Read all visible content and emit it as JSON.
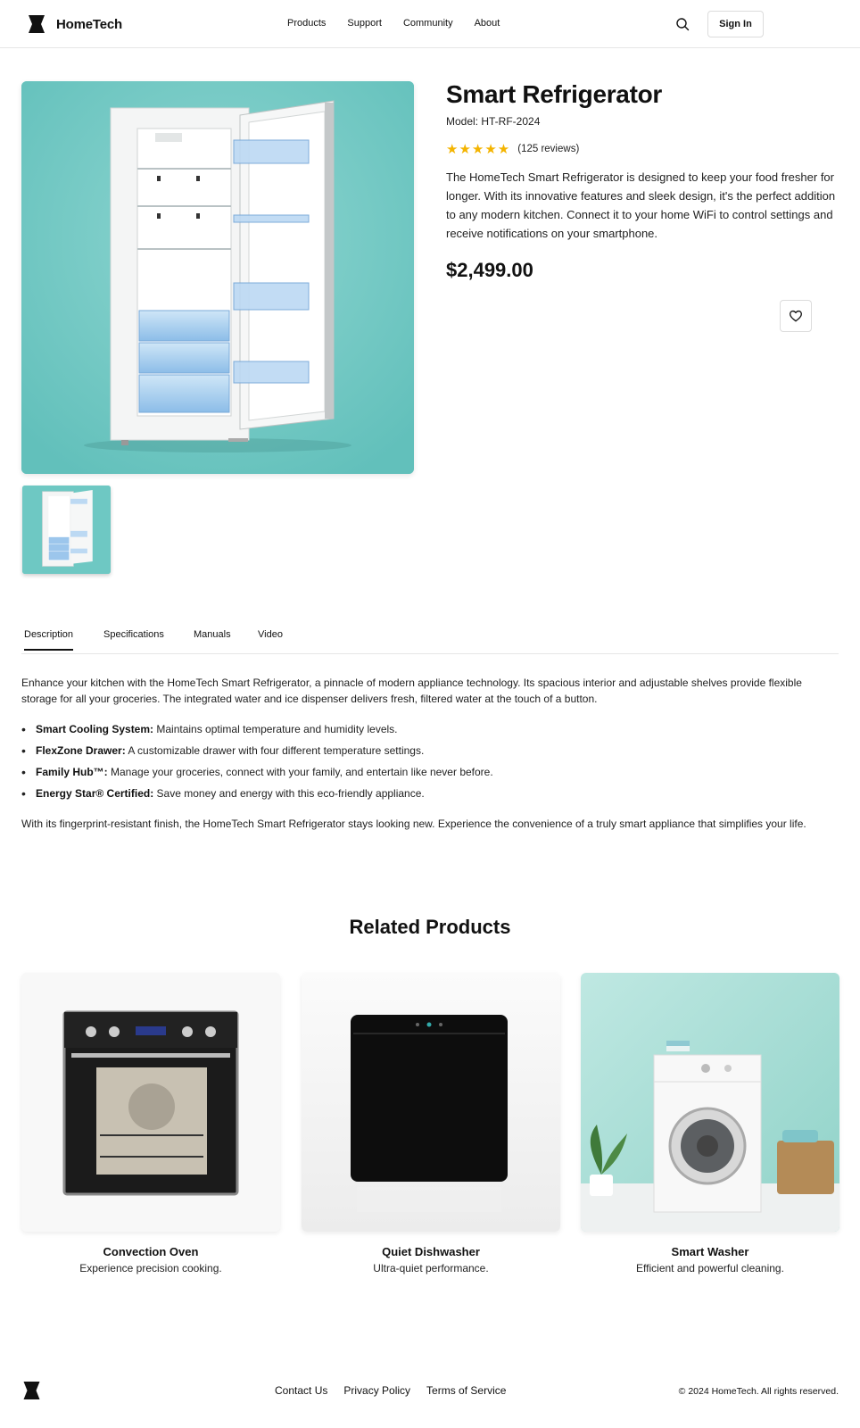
{
  "header": {
    "brand": "HomeTech",
    "nav": [
      "Products",
      "Support",
      "Community",
      "About"
    ],
    "signin": "Sign In"
  },
  "product": {
    "title": "Smart Refrigerator",
    "model": "Model: HT-RF-2024",
    "stars": "★★★★★",
    "rating_value": 5,
    "reviews": "(125 reviews)",
    "description": "The HomeTech Smart Refrigerator is designed to keep your food fresher for longer. With its innovative features and sleek design, it's the perfect addition to any modern kitchen. Connect it to your home WiFi to control settings and receive notifications on your smartphone.",
    "price": "$2,499.00"
  },
  "tabs": [
    "Description",
    "Specifications",
    "Manuals",
    "Video"
  ],
  "description": {
    "intro": "Enhance your kitchen with the HomeTech Smart Refrigerator, a pinnacle of modern appliance technology. Its spacious interior and adjustable shelves provide flexible storage for all your groceries. The integrated water and ice dispenser delivers fresh, filtered water at the touch of a button.",
    "features": [
      {
        "name": "Smart Cooling System:",
        "text": " Maintains optimal temperature and humidity levels."
      },
      {
        "name": "FlexZone Drawer:",
        "text": " A customizable drawer with four different temperature settings."
      },
      {
        "name": "Family Hub™:",
        "text": " Manage your groceries, connect with your family, and entertain like never before."
      },
      {
        "name": "Energy Star® Certified:",
        "text": " Save money and energy with this eco-friendly appliance."
      }
    ],
    "outro": "With its fingerprint-resistant finish, the HomeTech Smart Refrigerator stays looking new. Experience the convenience of a truly smart appliance that simplifies your life."
  },
  "related": {
    "title": "Related Products",
    "items": [
      {
        "name": "Convection Oven",
        "tagline": "Experience precision cooking."
      },
      {
        "name": "Quiet Dishwasher",
        "tagline": "Ultra-quiet performance."
      },
      {
        "name": "Smart Washer",
        "tagline": "Efficient and powerful cleaning."
      }
    ]
  },
  "footer": {
    "links": [
      "Contact Us",
      "Privacy Policy",
      "Terms of Service"
    ],
    "copyright": "© 2024 HomeTech. All rights reserved."
  },
  "colors": {
    "accent_teal": "#6ec8c3",
    "star": "#f4b400",
    "text": "#111111"
  },
  "icons": [
    "logo-icon",
    "search-icon",
    "heart-icon"
  ]
}
